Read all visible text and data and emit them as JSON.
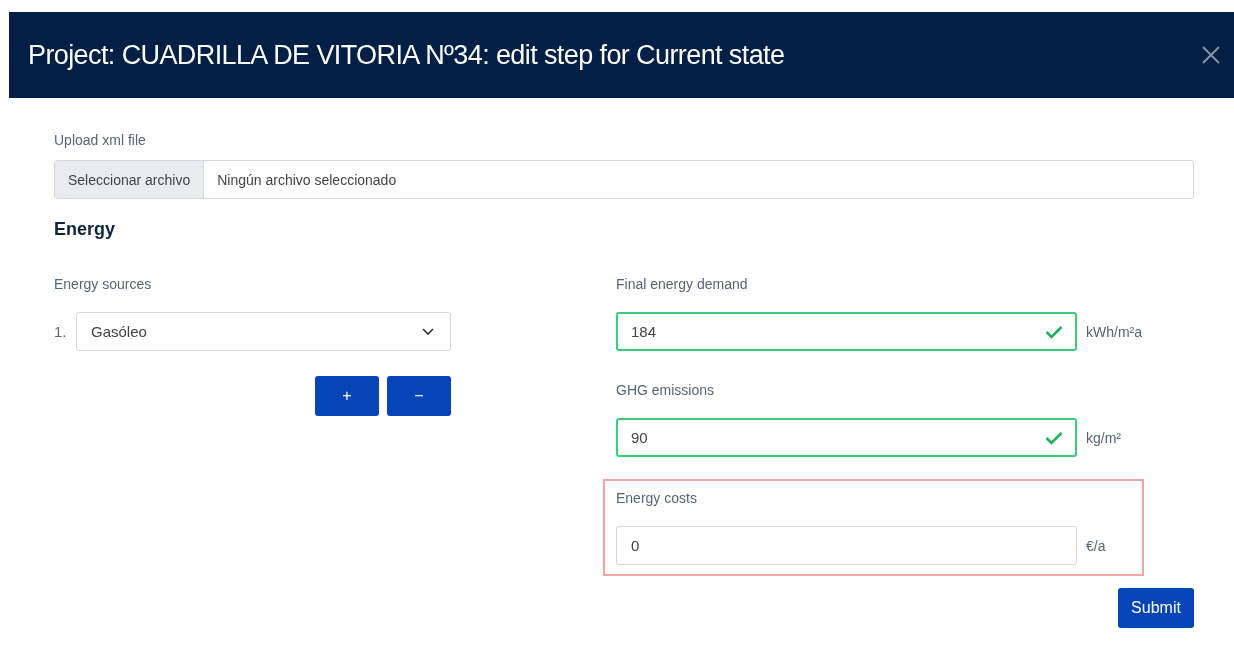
{
  "modal": {
    "title": "Project: CUADRILLA DE VITORIA Nº34: edit step for Current state"
  },
  "upload": {
    "label": "Upload xml file",
    "button": "Seleccionar archivo",
    "status": "Ningún archivo seleccionado"
  },
  "section": {
    "heading": "Energy"
  },
  "energy_sources": {
    "label": "Energy sources",
    "items": [
      {
        "number": "1.",
        "value": "Gasóleo"
      }
    ],
    "add_button": "+",
    "remove_button": "−"
  },
  "fields": [
    {
      "label": "Final energy demand",
      "value": "184",
      "unit": "kWh/m²a",
      "valid": true,
      "highlighted": false
    },
    {
      "label": "GHG emissions",
      "value": "90",
      "unit": "kg/m²",
      "valid": true,
      "highlighted": false
    },
    {
      "label": "Energy costs",
      "value": "0",
      "unit": "€/a",
      "valid": false,
      "highlighted": true
    }
  ],
  "submit_button": "Submit"
}
